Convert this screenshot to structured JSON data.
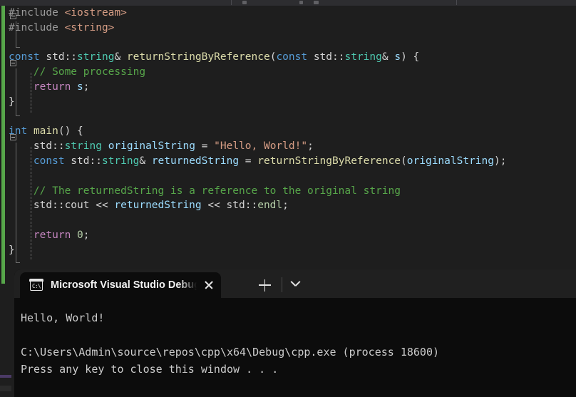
{
  "app": {
    "name": "visual-studio-code-editor",
    "theme": "dark"
  },
  "editor": {
    "language": "cpp",
    "lines": [
      {
        "id": 1,
        "indent": 0,
        "fold": "open",
        "tokens": [
          {
            "t": "#include ",
            "c": "t-pre"
          },
          {
            "t": "<iostream>",
            "c": "t-inc"
          }
        ]
      },
      {
        "id": 2,
        "indent": 0,
        "fold": "none",
        "tokens": [
          {
            "t": "#include ",
            "c": "t-pre"
          },
          {
            "t": "<string>",
            "c": "t-inc"
          }
        ]
      },
      {
        "id": 3,
        "indent": 0,
        "fold": "none",
        "tokens": []
      },
      {
        "id": 4,
        "indent": 0,
        "fold": "open",
        "tokens": [
          {
            "t": "const",
            "c": "t-kw"
          },
          {
            "t": " std::",
            "c": "t-ns"
          },
          {
            "t": "string",
            "c": "t-type"
          },
          {
            "t": "& ",
            "c": "t-pl"
          },
          {
            "t": "returnStringByReference",
            "c": "t-fn"
          },
          {
            "t": "(",
            "c": "t-pl"
          },
          {
            "t": "const",
            "c": "t-kw"
          },
          {
            "t": " std::",
            "c": "t-ns"
          },
          {
            "t": "string",
            "c": "t-type"
          },
          {
            "t": "& ",
            "c": "t-pl"
          },
          {
            "t": "s",
            "c": "t-var"
          },
          {
            "t": ") {",
            "c": "t-pl"
          }
        ]
      },
      {
        "id": 5,
        "indent": 0,
        "fold": "none",
        "tokens": [
          {
            "t": "    // Some processing",
            "c": "t-cmt"
          }
        ]
      },
      {
        "id": 6,
        "indent": 0,
        "fold": "none",
        "tokens": [
          {
            "t": "    ",
            "c": "t-pl"
          },
          {
            "t": "return",
            "c": "t-ctl"
          },
          {
            "t": " ",
            "c": "t-pl"
          },
          {
            "t": "s",
            "c": "t-var"
          },
          {
            "t": ";",
            "c": "t-pl"
          }
        ]
      },
      {
        "id": 7,
        "indent": 0,
        "fold": "none",
        "tokens": [
          {
            "t": "}",
            "c": "t-pl"
          }
        ]
      },
      {
        "id": 8,
        "indent": 0,
        "fold": "none",
        "tokens": []
      },
      {
        "id": 9,
        "indent": 0,
        "fold": "open",
        "tokens": [
          {
            "t": "int",
            "c": "t-kw"
          },
          {
            "t": " ",
            "c": "t-pl"
          },
          {
            "t": "main",
            "c": "t-fn"
          },
          {
            "t": "() {",
            "c": "t-pl"
          }
        ]
      },
      {
        "id": 10,
        "indent": 0,
        "fold": "none",
        "tokens": [
          {
            "t": "    std::",
            "c": "t-ns"
          },
          {
            "t": "string",
            "c": "t-type"
          },
          {
            "t": " ",
            "c": "t-pl"
          },
          {
            "t": "originalString",
            "c": "t-var"
          },
          {
            "t": " = ",
            "c": "t-pl"
          },
          {
            "t": "\"Hello, World!\"",
            "c": "t-str"
          },
          {
            "t": ";",
            "c": "t-pl"
          }
        ]
      },
      {
        "id": 11,
        "indent": 0,
        "fold": "none",
        "tokens": [
          {
            "t": "    ",
            "c": "t-pl"
          },
          {
            "t": "const",
            "c": "t-kw"
          },
          {
            "t": " std::",
            "c": "t-ns"
          },
          {
            "t": "string",
            "c": "t-type"
          },
          {
            "t": "& ",
            "c": "t-pl"
          },
          {
            "t": "returnedString",
            "c": "t-var"
          },
          {
            "t": " = ",
            "c": "t-pl"
          },
          {
            "t": "returnStringByReference",
            "c": "t-fn"
          },
          {
            "t": "(",
            "c": "t-pl"
          },
          {
            "t": "originalString",
            "c": "t-var"
          },
          {
            "t": ");",
            "c": "t-pl"
          }
        ]
      },
      {
        "id": 12,
        "indent": 0,
        "fold": "none",
        "tokens": []
      },
      {
        "id": 13,
        "indent": 0,
        "fold": "none",
        "tokens": [
          {
            "t": "    // The returnedString is a reference to the original string",
            "c": "t-cmt"
          }
        ]
      },
      {
        "id": 14,
        "indent": 0,
        "fold": "none",
        "tokens": [
          {
            "t": "    std::",
            "c": "t-ns"
          },
          {
            "t": "cout",
            "c": "t-pl"
          },
          {
            "t": " << ",
            "c": "t-pl"
          },
          {
            "t": "returnedString",
            "c": "t-var"
          },
          {
            "t": " << std::",
            "c": "t-pl"
          },
          {
            "t": "endl",
            "c": "t-num"
          },
          {
            "t": ";",
            "c": "t-pl"
          }
        ]
      },
      {
        "id": 15,
        "indent": 0,
        "fold": "none",
        "tokens": []
      },
      {
        "id": 16,
        "indent": 0,
        "fold": "none",
        "tokens": [
          {
            "t": "    ",
            "c": "t-pl"
          },
          {
            "t": "return",
            "c": "t-ctl"
          },
          {
            "t": " ",
            "c": "t-pl"
          },
          {
            "t": "0",
            "c": "t-num"
          },
          {
            "t": ";",
            "c": "t-pl"
          }
        ]
      },
      {
        "id": 17,
        "indent": 0,
        "fold": "none",
        "tokens": [
          {
            "t": "}",
            "c": "t-pl"
          }
        ]
      }
    ]
  },
  "terminal": {
    "tab": {
      "icon_label": "C:\\",
      "title": "Microsoft Visual Studio Debug",
      "close_label": "Close",
      "new_tab_label": "+",
      "dropdown_label": "v"
    },
    "output": [
      "Hello, World!",
      "",
      "C:\\Users\\Admin\\source\\repos\\cpp\\x64\\Debug\\cpp.exe (process 18600)",
      "Press any key to close this window . . ."
    ]
  },
  "colors": {
    "editor_bg": "#1e1e1e",
    "terminal_bg": "#0c0c0c",
    "tabbar_bg": "#202020",
    "change_margin": "#57a64a",
    "keyword": "#569cd6",
    "type": "#4ec9b0",
    "function": "#dcdcaa",
    "variable": "#9cdcfe",
    "comment": "#57a64a",
    "string": "#d69d85",
    "control": "#c586c0",
    "number": "#b5cea8",
    "preprocessor": "#9b9b9b",
    "plain": "#d4d4d4"
  }
}
